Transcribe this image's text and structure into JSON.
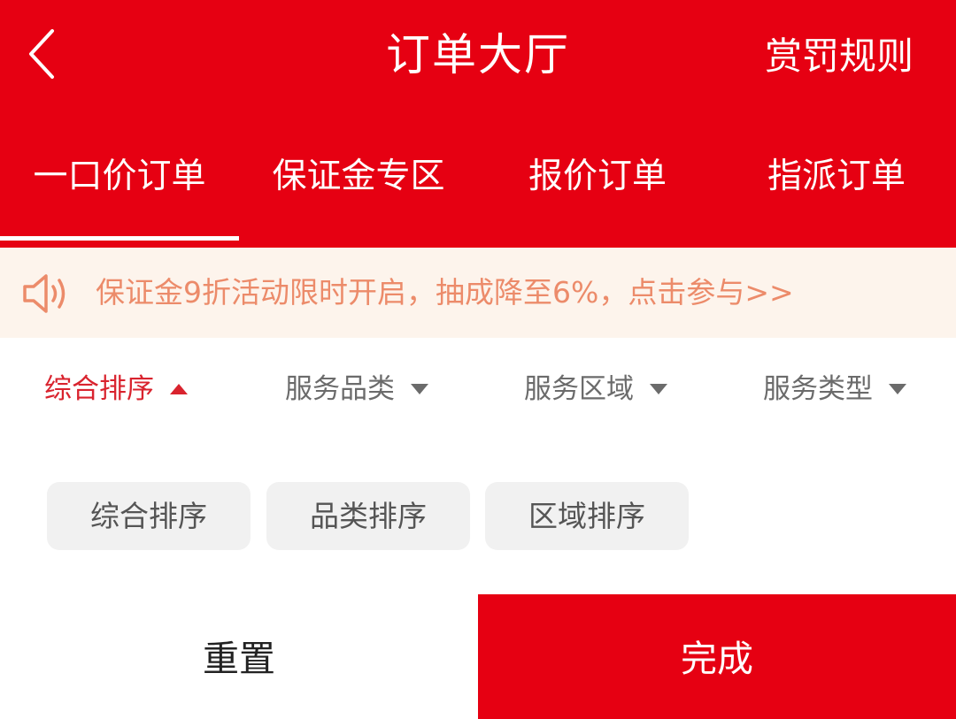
{
  "header": {
    "title": "订单大厅",
    "right_link": "赏罚规则",
    "background_color": "#e60012"
  },
  "tabs": {
    "items": [
      {
        "label": "一口价订单",
        "active": true
      },
      {
        "label": "保证金专区",
        "active": false
      },
      {
        "label": "报价订单",
        "active": false
      },
      {
        "label": "指派订单",
        "active": false
      }
    ]
  },
  "notice": {
    "icon": "speaker-icon",
    "text": "保证金9折活动限时开启，抽成降至6%，点击参与>>",
    "text_color": "#ec8b6a",
    "background_color": "#fdf4ec"
  },
  "filters": {
    "items": [
      {
        "label": "综合排序",
        "active": true
      },
      {
        "label": "服务品类",
        "active": false
      },
      {
        "label": "服务区域",
        "active": false
      },
      {
        "label": "服务类型",
        "active": false
      }
    ],
    "active_color": "#d9232e"
  },
  "sort_options": [
    {
      "label": "综合排序"
    },
    {
      "label": "品类排序"
    },
    {
      "label": "区域排序"
    }
  ],
  "actions": {
    "reset_label": "重置",
    "done_label": "完成"
  }
}
